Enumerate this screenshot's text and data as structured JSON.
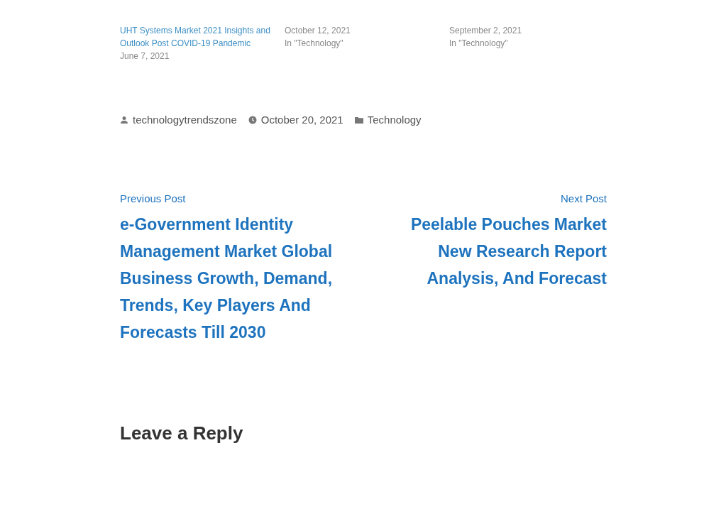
{
  "related": [
    {
      "title": "UHT Systems Market 2021 Insights and Outlook Post COVID-19 Pandemic",
      "date": "June 7, 2021"
    },
    {
      "date": "October 12, 2021",
      "category": "In \"Technology\""
    },
    {
      "date": "September 2, 2021",
      "category": "In \"Technology\""
    }
  ],
  "meta": {
    "author": "technologytrendszone",
    "date": "October 20, 2021",
    "category": "Technology"
  },
  "navigation": {
    "previous": {
      "label": "Previous Post",
      "title": "e-Government Identity Management Market Global Business Growth, Demand, Trends, Key Players And Forecasts Till 2030"
    },
    "next": {
      "label": "Next Post",
      "title": "Peelable Pouches Market New Research Report Analysis, And Forecast"
    }
  },
  "reply_heading": "Leave a Reply"
}
